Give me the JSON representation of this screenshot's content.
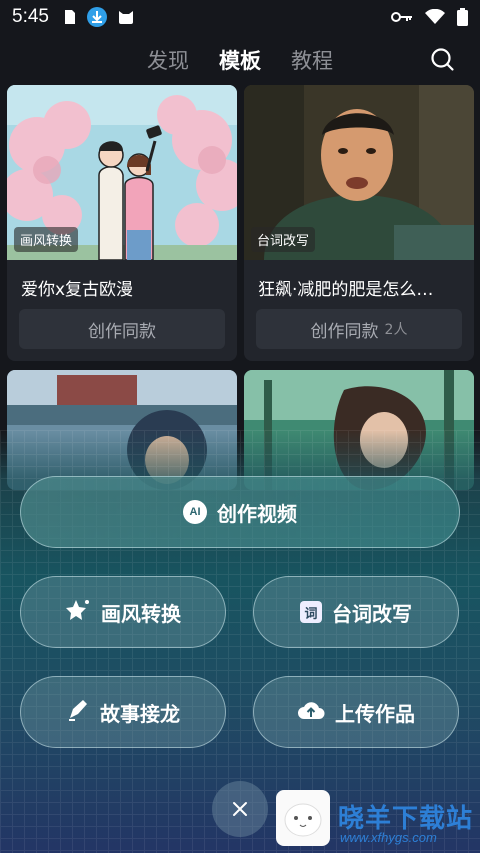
{
  "status": {
    "time": "5:45"
  },
  "nav": {
    "tabs": [
      {
        "label": "发现",
        "active": false
      },
      {
        "label": "模板",
        "active": true
      },
      {
        "label": "教程",
        "active": false
      }
    ]
  },
  "cards": [
    {
      "tag": "画风转换",
      "title": "爱你x复古欧漫",
      "button": "创作同款",
      "count": ""
    },
    {
      "tag": "台词改写",
      "title": "狂飙·减肥的肥是怎么…",
      "button": "创作同款",
      "count": "2人"
    }
  ],
  "actions": {
    "create_video": {
      "label": "创作视频",
      "badge": "AI"
    },
    "style_transfer": {
      "label": "画风转换"
    },
    "rewrite_lines": {
      "label": "台词改写",
      "badge": "词"
    },
    "story_relay": {
      "label": "故事接龙"
    },
    "upload_work": {
      "label": "上传作品"
    }
  },
  "watermark": {
    "title": "晓羊下载站",
    "url": "www.xfhygs.com"
  },
  "colors": {
    "accent": "#2d7fd6",
    "background": "#15171c",
    "card_bg": "#22252c"
  }
}
